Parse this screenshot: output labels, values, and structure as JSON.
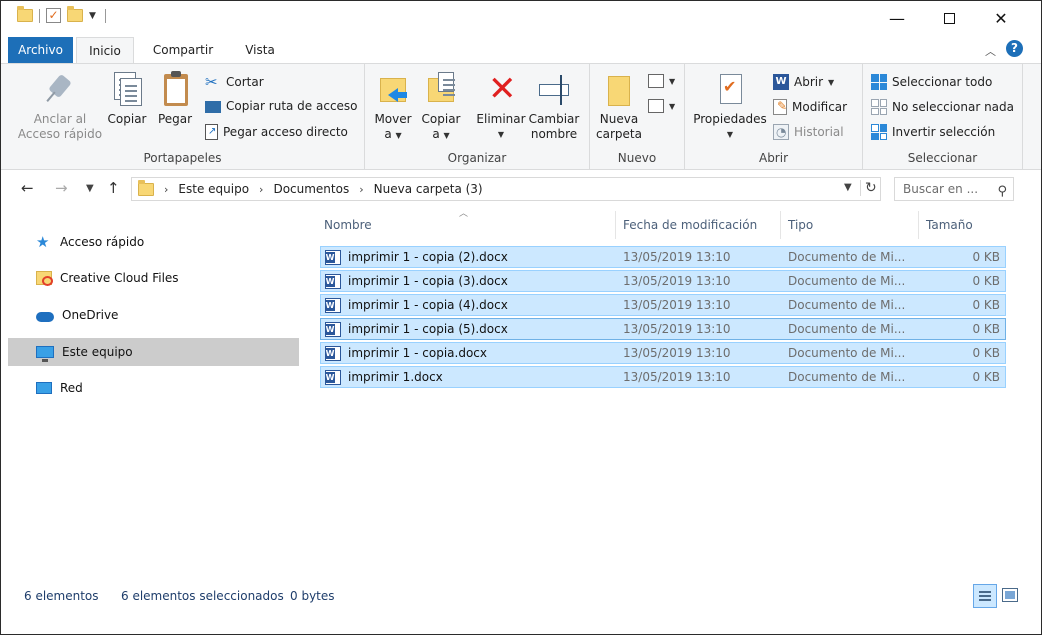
{
  "ribbon_tabs": {
    "archivo": "Archivo",
    "inicio": "Inicio",
    "compartir": "Compartir",
    "vista": "Vista"
  },
  "portapapeles": {
    "anclar": "Anclar al",
    "anclar2": "Acceso rápido",
    "copiar": "Copiar",
    "pegar": "Pegar",
    "cortar": "Cortar",
    "copiar_ruta": "Copiar ruta de acceso",
    "pegar_acceso": "Pegar acceso directo",
    "label": "Portapapeles"
  },
  "organizar": {
    "mover1": "Mover",
    "mover2": "a",
    "copiar1": "Copiar",
    "copiar2": "a",
    "eliminar": "Eliminar",
    "cambiar1": "Cambiar",
    "cambiar2": "nombre",
    "label": "Organizar"
  },
  "nuevo": {
    "nueva1": "Nueva",
    "nueva2": "carpeta",
    "label": "Nuevo"
  },
  "abrir": {
    "propiedades": "Propiedades",
    "abrir": "Abrir",
    "modificar": "Modificar",
    "historial": "Historial",
    "label": "Abrir"
  },
  "seleccionar": {
    "todo": "Seleccionar todo",
    "nada": "No seleccionar nada",
    "invertir": "Invertir selección",
    "label": "Seleccionar"
  },
  "address": {
    "crumbs": [
      "Este equipo",
      "Documentos",
      "Nueva carpeta (3)"
    ],
    "search_placeholder": "Buscar en ..."
  },
  "nav_pane": [
    "Acceso rápido",
    "Creative Cloud Files",
    "OneDrive",
    "Este equipo",
    "Red"
  ],
  "columns": {
    "name": "Nombre",
    "date": "Fecha de modificación",
    "type": "Tipo",
    "size": "Tamaño"
  },
  "files": [
    {
      "name": "imprimir 1 - copia (2).docx",
      "date": "13/05/2019 13:10",
      "type": "Documento de Mi...",
      "size": "0 KB"
    },
    {
      "name": "imprimir 1 - copia (3).docx",
      "date": "13/05/2019 13:10",
      "type": "Documento de Mi...",
      "size": "0 KB"
    },
    {
      "name": "imprimir 1 - copia (4).docx",
      "date": "13/05/2019 13:10",
      "type": "Documento de Mi...",
      "size": "0 KB"
    },
    {
      "name": "imprimir 1 - copia (5).docx",
      "date": "13/05/2019 13:10",
      "type": "Documento de Mi...",
      "size": "0 KB"
    },
    {
      "name": "imprimir 1 - copia.docx",
      "date": "13/05/2019 13:10",
      "type": "Documento de Mi...",
      "size": "0 KB"
    },
    {
      "name": "imprimir 1.docx",
      "date": "13/05/2019 13:10",
      "type": "Documento de Mi...",
      "size": "0 KB"
    }
  ],
  "status": {
    "count": "6 elementos",
    "selected": "6 elementos seleccionados",
    "bytes": "0 bytes"
  },
  "colors": {
    "accent": "#1d6fb8",
    "selection": "#cce8ff",
    "selection_border": "#99d1ff"
  }
}
